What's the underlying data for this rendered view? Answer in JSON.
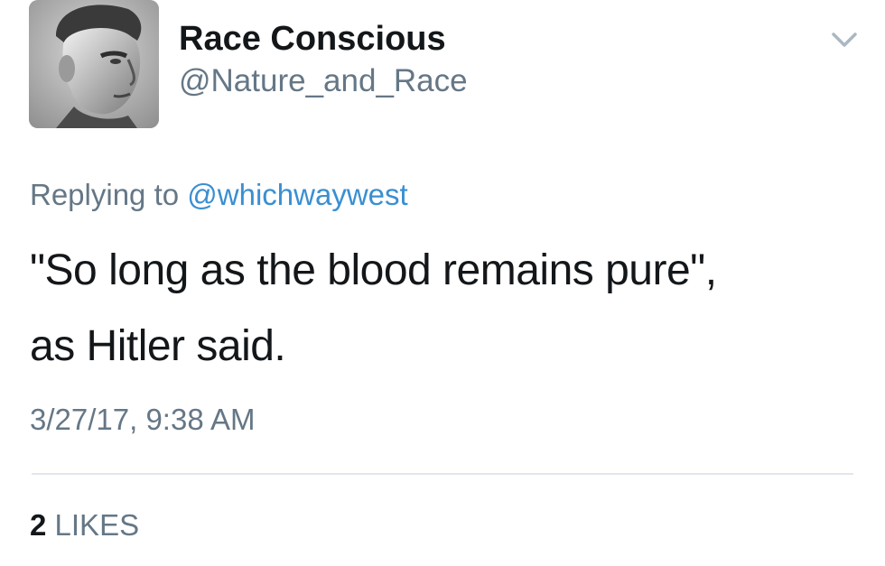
{
  "tweet": {
    "author": {
      "display_name": "Race Conscious",
      "handle": "@Nature_and_Race",
      "avatar_icon": "profile-photo"
    },
    "reply": {
      "prefix": "Replying to",
      "target": "@whichwaywest"
    },
    "text_line_1": "\"So long as the blood remains pure\",",
    "text_line_2": "as Hitler said.",
    "timestamp": "3/27/17, 9:38 AM",
    "likes": {
      "count": "2",
      "label": "LIKES"
    },
    "menu_icon": "chevron-down-icon"
  },
  "colors": {
    "text_primary": "#14171a",
    "text_secondary": "#657786",
    "link": "#3a8fd1",
    "divider": "#e1e8ed",
    "chevron": "#aab8c2"
  }
}
